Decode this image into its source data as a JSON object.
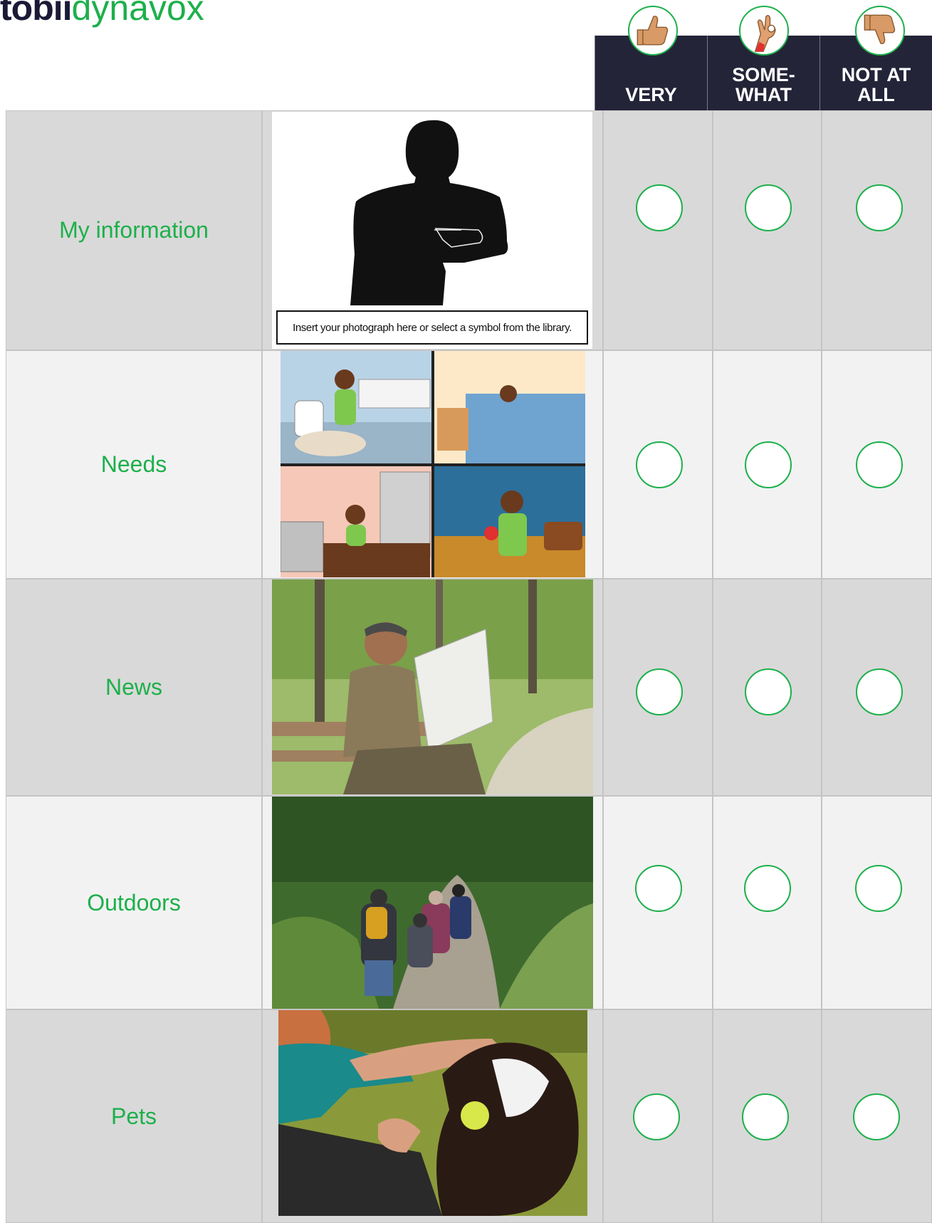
{
  "brand": {
    "part1": "tobii",
    "part2": "dynavox"
  },
  "columns": [
    {
      "line1": "",
      "line2": "VERY",
      "icon": "thumbs-up-icon"
    },
    {
      "line1": "SOME-",
      "line2": "WHAT",
      "icon": "ok-hand-icon"
    },
    {
      "line1": "NOT AT",
      "line2": "ALL",
      "icon": "thumbs-down-icon"
    }
  ],
  "rows": [
    {
      "label": "My information",
      "image": "silhouette-pointing-image",
      "caption": "Insert your photograph here or select a symbol from the library."
    },
    {
      "label": "Needs",
      "image": "needs-illustration-image"
    },
    {
      "label": "News",
      "image": "man-reading-newspaper-photo"
    },
    {
      "label": "Outdoors",
      "image": "family-hiking-photo"
    },
    {
      "label": "Pets",
      "image": "woman-with-dog-photo"
    }
  ],
  "colors": {
    "accent": "#1db04b",
    "header": "#242439",
    "row_dark": "#d9d9d9",
    "row_light": "#f2f2f2"
  }
}
